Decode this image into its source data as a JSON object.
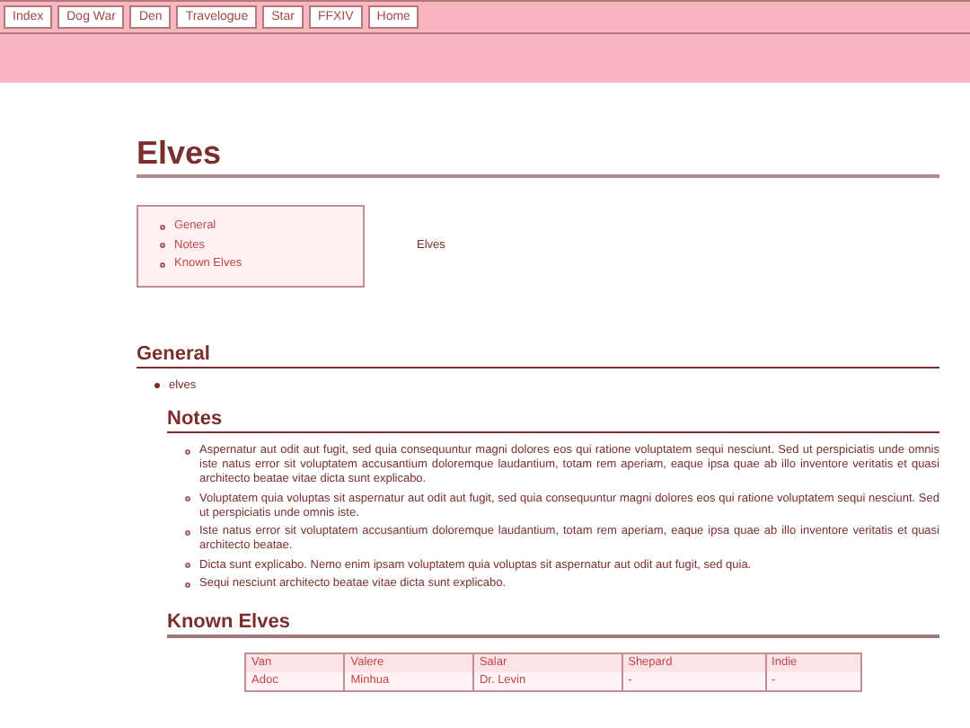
{
  "nav": [
    "Index",
    "Dog War",
    "Den",
    "Travelogue",
    "Star",
    "FFXIV",
    "Home"
  ],
  "title": "Elves",
  "toc": [
    "General",
    "Notes",
    "Known Elves"
  ],
  "toc_side": "Elves",
  "general": {
    "heading": "General",
    "items": [
      "elves"
    ]
  },
  "notes": {
    "heading": "Notes",
    "items": [
      "Aspernatur aut odit aut fugit, sed quia consequuntur magni dolores eos qui ratione voluptatem sequi nesciunt. Sed ut perspiciatis unde omnis iste natus error sit voluptatem accusantium doloremque laudantium, totam rem aperiam, eaque ipsa quae ab illo inventore veritatis et quasi architecto beatae vitae dicta sunt explicabo.",
      "Voluptatem quia voluptas sit aspernatur aut odit aut fugit, sed quia consequuntur magni dolores eos qui ratione voluptatem sequi nesciunt. Sed ut perspiciatis unde omnis iste.",
      "Iste natus error sit voluptatem accusantium doloremque laudantium, totam rem aperiam, eaque ipsa quae ab illo inventore veritatis et quasi architecto beatae.",
      "Dicta sunt explicabo. Nemo enim ipsam voluptatem quia voluptas sit aspernatur aut odit aut fugit, sed quia.",
      "Sequi nesciunt architecto beatae vitae dicta sunt explicabo."
    ]
  },
  "known": {
    "heading": "Known Elves",
    "rows": [
      [
        "Van",
        "Valere",
        "Salar",
        "Shepard",
        "Indie"
      ],
      [
        "Adoc",
        "Minhua",
        "Dr. Levin",
        "-",
        "-"
      ]
    ]
  }
}
